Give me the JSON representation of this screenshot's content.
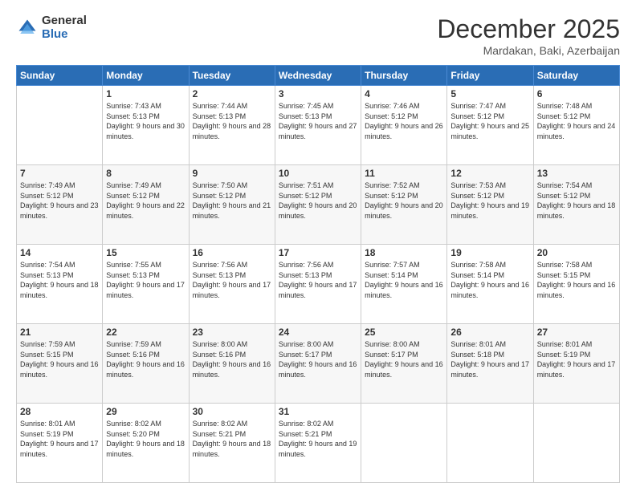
{
  "logo": {
    "general": "General",
    "blue": "Blue"
  },
  "title": "December 2025",
  "subtitle": "Mardakan, Baki, Azerbaijan",
  "days_of_week": [
    "Sunday",
    "Monday",
    "Tuesday",
    "Wednesday",
    "Thursday",
    "Friday",
    "Saturday"
  ],
  "weeks": [
    [
      {
        "day": "",
        "sunrise": "",
        "sunset": "",
        "daylight": ""
      },
      {
        "day": "1",
        "sunrise": "7:43 AM",
        "sunset": "5:13 PM",
        "daylight": "9 hours and 30 minutes."
      },
      {
        "day": "2",
        "sunrise": "7:44 AM",
        "sunset": "5:13 PM",
        "daylight": "9 hours and 28 minutes."
      },
      {
        "day": "3",
        "sunrise": "7:45 AM",
        "sunset": "5:13 PM",
        "daylight": "9 hours and 27 minutes."
      },
      {
        "day": "4",
        "sunrise": "7:46 AM",
        "sunset": "5:12 PM",
        "daylight": "9 hours and 26 minutes."
      },
      {
        "day": "5",
        "sunrise": "7:47 AM",
        "sunset": "5:12 PM",
        "daylight": "9 hours and 25 minutes."
      },
      {
        "day": "6",
        "sunrise": "7:48 AM",
        "sunset": "5:12 PM",
        "daylight": "9 hours and 24 minutes."
      }
    ],
    [
      {
        "day": "7",
        "sunrise": "7:49 AM",
        "sunset": "5:12 PM",
        "daylight": "9 hours and 23 minutes."
      },
      {
        "day": "8",
        "sunrise": "7:49 AM",
        "sunset": "5:12 PM",
        "daylight": "9 hours and 22 minutes."
      },
      {
        "day": "9",
        "sunrise": "7:50 AM",
        "sunset": "5:12 PM",
        "daylight": "9 hours and 21 minutes."
      },
      {
        "day": "10",
        "sunrise": "7:51 AM",
        "sunset": "5:12 PM",
        "daylight": "9 hours and 20 minutes."
      },
      {
        "day": "11",
        "sunrise": "7:52 AM",
        "sunset": "5:12 PM",
        "daylight": "9 hours and 20 minutes."
      },
      {
        "day": "12",
        "sunrise": "7:53 AM",
        "sunset": "5:12 PM",
        "daylight": "9 hours and 19 minutes."
      },
      {
        "day": "13",
        "sunrise": "7:54 AM",
        "sunset": "5:12 PM",
        "daylight": "9 hours and 18 minutes."
      }
    ],
    [
      {
        "day": "14",
        "sunrise": "7:54 AM",
        "sunset": "5:13 PM",
        "daylight": "9 hours and 18 minutes."
      },
      {
        "day": "15",
        "sunrise": "7:55 AM",
        "sunset": "5:13 PM",
        "daylight": "9 hours and 17 minutes."
      },
      {
        "day": "16",
        "sunrise": "7:56 AM",
        "sunset": "5:13 PM",
        "daylight": "9 hours and 17 minutes."
      },
      {
        "day": "17",
        "sunrise": "7:56 AM",
        "sunset": "5:13 PM",
        "daylight": "9 hours and 17 minutes."
      },
      {
        "day": "18",
        "sunrise": "7:57 AM",
        "sunset": "5:14 PM",
        "daylight": "9 hours and 16 minutes."
      },
      {
        "day": "19",
        "sunrise": "7:58 AM",
        "sunset": "5:14 PM",
        "daylight": "9 hours and 16 minutes."
      },
      {
        "day": "20",
        "sunrise": "7:58 AM",
        "sunset": "5:15 PM",
        "daylight": "9 hours and 16 minutes."
      }
    ],
    [
      {
        "day": "21",
        "sunrise": "7:59 AM",
        "sunset": "5:15 PM",
        "daylight": "9 hours and 16 minutes."
      },
      {
        "day": "22",
        "sunrise": "7:59 AM",
        "sunset": "5:16 PM",
        "daylight": "9 hours and 16 minutes."
      },
      {
        "day": "23",
        "sunrise": "8:00 AM",
        "sunset": "5:16 PM",
        "daylight": "9 hours and 16 minutes."
      },
      {
        "day": "24",
        "sunrise": "8:00 AM",
        "sunset": "5:17 PM",
        "daylight": "9 hours and 16 minutes."
      },
      {
        "day": "25",
        "sunrise": "8:00 AM",
        "sunset": "5:17 PM",
        "daylight": "9 hours and 16 minutes."
      },
      {
        "day": "26",
        "sunrise": "8:01 AM",
        "sunset": "5:18 PM",
        "daylight": "9 hours and 17 minutes."
      },
      {
        "day": "27",
        "sunrise": "8:01 AM",
        "sunset": "5:19 PM",
        "daylight": "9 hours and 17 minutes."
      }
    ],
    [
      {
        "day": "28",
        "sunrise": "8:01 AM",
        "sunset": "5:19 PM",
        "daylight": "9 hours and 17 minutes."
      },
      {
        "day": "29",
        "sunrise": "8:02 AM",
        "sunset": "5:20 PM",
        "daylight": "9 hours and 18 minutes."
      },
      {
        "day": "30",
        "sunrise": "8:02 AM",
        "sunset": "5:21 PM",
        "daylight": "9 hours and 18 minutes."
      },
      {
        "day": "31",
        "sunrise": "8:02 AM",
        "sunset": "5:21 PM",
        "daylight": "9 hours and 19 minutes."
      },
      {
        "day": "",
        "sunrise": "",
        "sunset": "",
        "daylight": ""
      },
      {
        "day": "",
        "sunrise": "",
        "sunset": "",
        "daylight": ""
      },
      {
        "day": "",
        "sunrise": "",
        "sunset": "",
        "daylight": ""
      }
    ]
  ],
  "labels": {
    "sunrise": "Sunrise:",
    "sunset": "Sunset:",
    "daylight": "Daylight:"
  }
}
